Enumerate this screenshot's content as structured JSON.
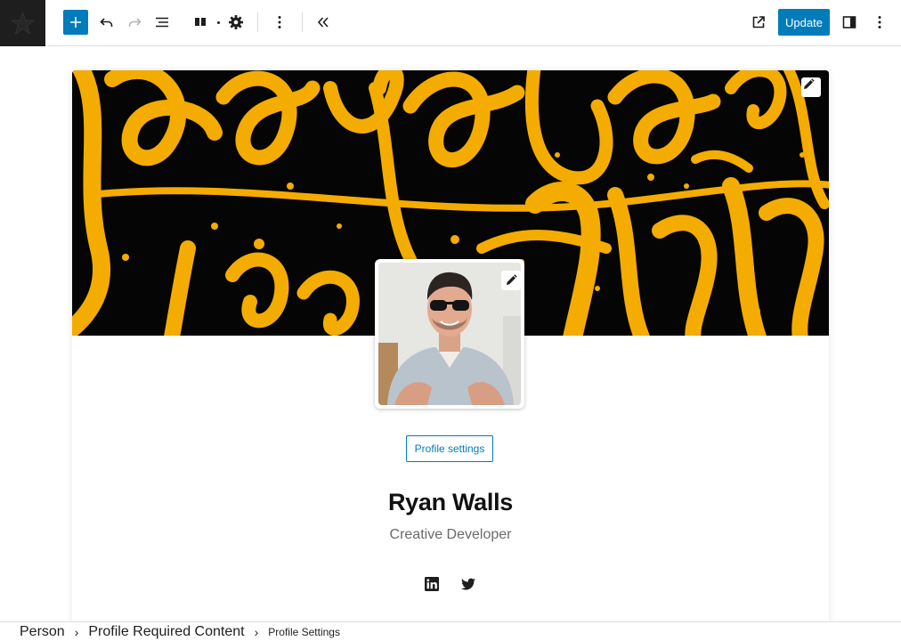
{
  "toolbar": {
    "update_label": "Update",
    "icons": [
      "add-block-icon",
      "undo-icon",
      "redo-icon",
      "list-view-icon",
      "columns-icon",
      "settings-gear-icon",
      "more-vertical-icon",
      "collapse-icon",
      "external-view-icon",
      "sidebar-toggle-icon"
    ],
    "accent_color": "#007cba"
  },
  "profile": {
    "settings_label": "Profile settings",
    "name": "Ryan Walls",
    "role": "Creative Developer",
    "social": [
      "linkedin-icon",
      "twitter-icon"
    ]
  },
  "cover": {
    "background": "#050505",
    "accent": "#f4ac00"
  },
  "breadcrumb": {
    "items": [
      "Person",
      "Profile Required Content",
      "Profile Settings"
    ]
  }
}
